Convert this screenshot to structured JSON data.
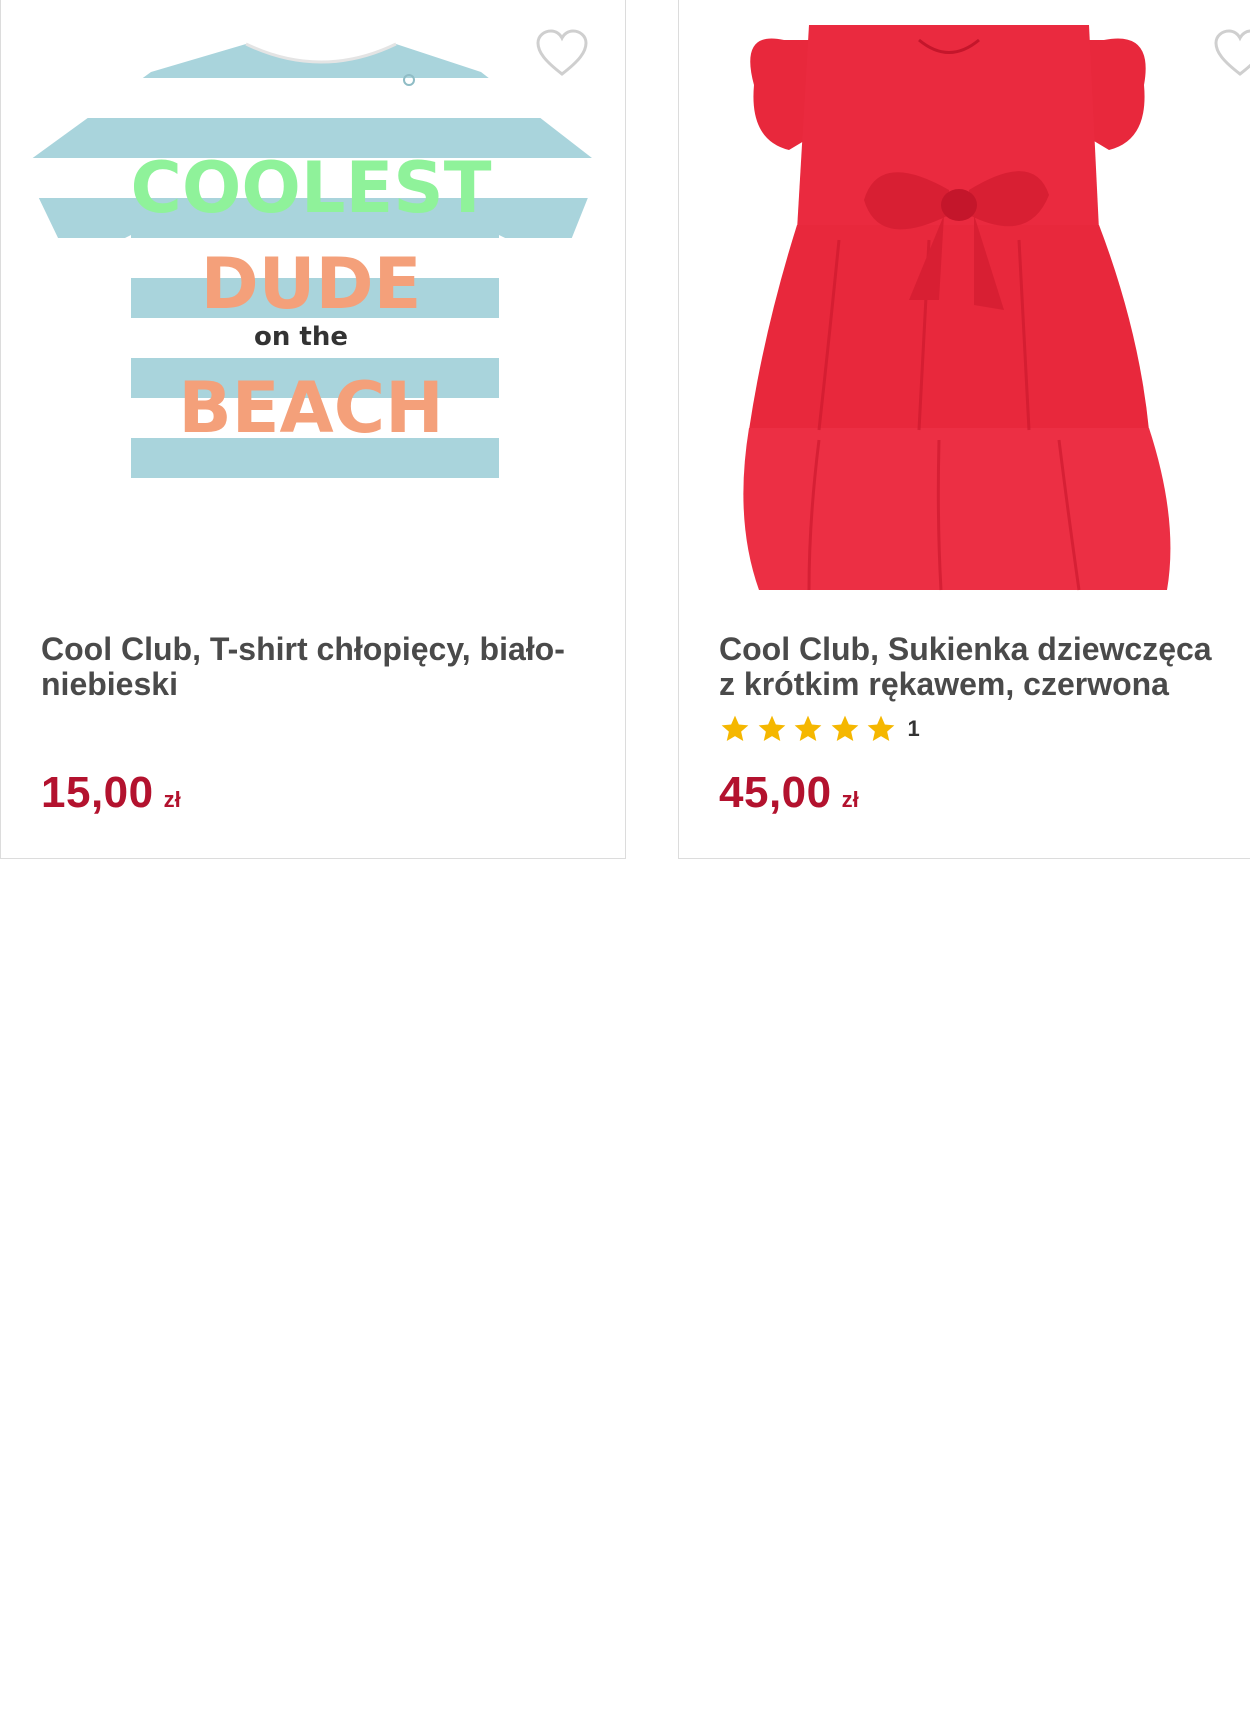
{
  "products": [
    {
      "title": "Cool Club, T-shirt chłopięcy, biało-niebieski",
      "price_amount": "15,00",
      "price_currency": "zł",
      "image_text": {
        "line1": "COOLEST",
        "line2": "DUDE",
        "line3": "on the",
        "line4": "BEACH"
      },
      "favorite_icon": "heart-outline-icon"
    },
    {
      "title": "Cool Club, Sukienka dziewczęca z krótkim rękawem, czerwona",
      "rating_stars": 5,
      "rating_count": "1",
      "price_amount": "45,00",
      "price_currency": "zł",
      "favorite_icon": "heart-outline-icon"
    }
  ],
  "colors": {
    "price": "#b3122e",
    "star": "#f5b700",
    "title": "#4a4a4a",
    "border": "#dcdcdc"
  }
}
